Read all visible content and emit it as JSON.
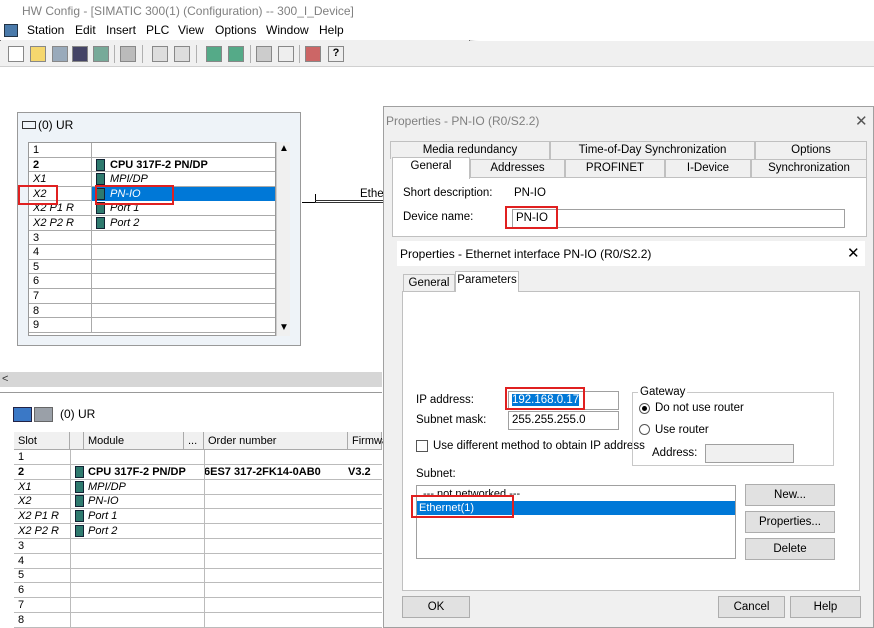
{
  "window": {
    "title": "HW Config - [SIMATIC 300(1) (Configuration) -- 300_I_Device]"
  },
  "menu": [
    "Station",
    "Edit",
    "Insert",
    "PLC",
    "View",
    "Options",
    "Window",
    "Help"
  ],
  "toolbar": {
    "icons": [
      "new-icon",
      "open-icon",
      "network-icon",
      "save-icon",
      "compile-icon",
      "print-icon",
      "copy-icon",
      "paste-icon",
      "download-icon",
      "upload-icon",
      "catalog-icon",
      "network-view-icon",
      "diagnostics-icon",
      "help-icon"
    ]
  },
  "rack": {
    "title": "(0) UR",
    "rows": [
      {
        "slot": "1",
        "module": ""
      },
      {
        "slot": "2",
        "module": "CPU 317F-2 PN/DP",
        "bold": true
      },
      {
        "slot": "X1",
        "module": "MPI/DP",
        "italic": true
      },
      {
        "slot": "X2",
        "module": "PN-IO",
        "italic": true,
        "selected": true
      },
      {
        "slot": "X2 P1 R",
        "module": "Port 1",
        "italic": true
      },
      {
        "slot": "X2 P2 R",
        "module": "Port 2",
        "italic": true
      },
      {
        "slot": "3",
        "module": ""
      },
      {
        "slot": "4",
        "module": ""
      },
      {
        "slot": "5",
        "module": ""
      },
      {
        "slot": "6",
        "module": ""
      },
      {
        "slot": "7",
        "module": ""
      },
      {
        "slot": "8",
        "module": ""
      },
      {
        "slot": "9",
        "module": ""
      }
    ],
    "ethernet_label": "Ether"
  },
  "lower": {
    "title": "(0)   UR",
    "headers": [
      "Slot",
      "Module",
      "...",
      "Order number",
      "Firmwa"
    ],
    "rows": [
      {
        "slot": "1",
        "module": "",
        "order": "",
        "fw": ""
      },
      {
        "slot": "2",
        "module": "CPU 317F-2 PN/DP",
        "order": "6ES7 317-2FK14-0AB0",
        "fw": "V3.2"
      },
      {
        "slot": "X1",
        "module": "MPI/DP",
        "order": "",
        "fw": ""
      },
      {
        "slot": "X2",
        "module": "PN-IO",
        "order": "",
        "fw": ""
      },
      {
        "slot": "X2 P1 R",
        "module": "Port 1",
        "order": "",
        "fw": ""
      },
      {
        "slot": "X2 P2 R",
        "module": "Port 2",
        "order": "",
        "fw": ""
      },
      {
        "slot": "3",
        "module": "",
        "order": "",
        "fw": ""
      },
      {
        "slot": "4",
        "module": "",
        "order": "",
        "fw": ""
      },
      {
        "slot": "5",
        "module": "",
        "order": "",
        "fw": ""
      },
      {
        "slot": "6",
        "module": "",
        "order": "",
        "fw": ""
      },
      {
        "slot": "7",
        "module": "",
        "order": "",
        "fw": ""
      },
      {
        "slot": "8",
        "module": "",
        "order": "",
        "fw": ""
      }
    ]
  },
  "pn_dialog": {
    "title": "Properties - PN-IO (R0/S2.2)",
    "tabs_row1": [
      "Media redundancy",
      "Time-of-Day Synchronization",
      "Options"
    ],
    "tabs_row2": [
      "General",
      "Addresses",
      "PROFINET",
      "I-Device",
      "Synchronization"
    ],
    "short_desc_label": "Short description:",
    "short_desc_value": "PN-IO",
    "device_name_label": "Device name:",
    "device_name_value": "PN-IO"
  },
  "eth_dialog": {
    "title": "Properties - Ethernet interface  PN-IO (R0/S2.2)",
    "tabs": [
      "General",
      "Parameters"
    ],
    "ip_label": "IP address:",
    "ip_value": "192.168.0.17",
    "mask_label": "Subnet mask:",
    "mask_value": "255.255.255.0",
    "diff_method_label": "Use different method to obtain IP address",
    "gateway_label": "Gateway",
    "no_router_label": "Do not use router",
    "use_router_label": "Use router",
    "address_label": "Address:",
    "subnet_label": "Subnet:",
    "subnets": [
      "--- not networked ---",
      "Ethernet(1)"
    ],
    "new_btn": "New...",
    "props_btn": "Properties...",
    "delete_btn": "Delete",
    "ok_btn": "OK",
    "cancel_btn": "Cancel",
    "help_btn": "Help"
  }
}
